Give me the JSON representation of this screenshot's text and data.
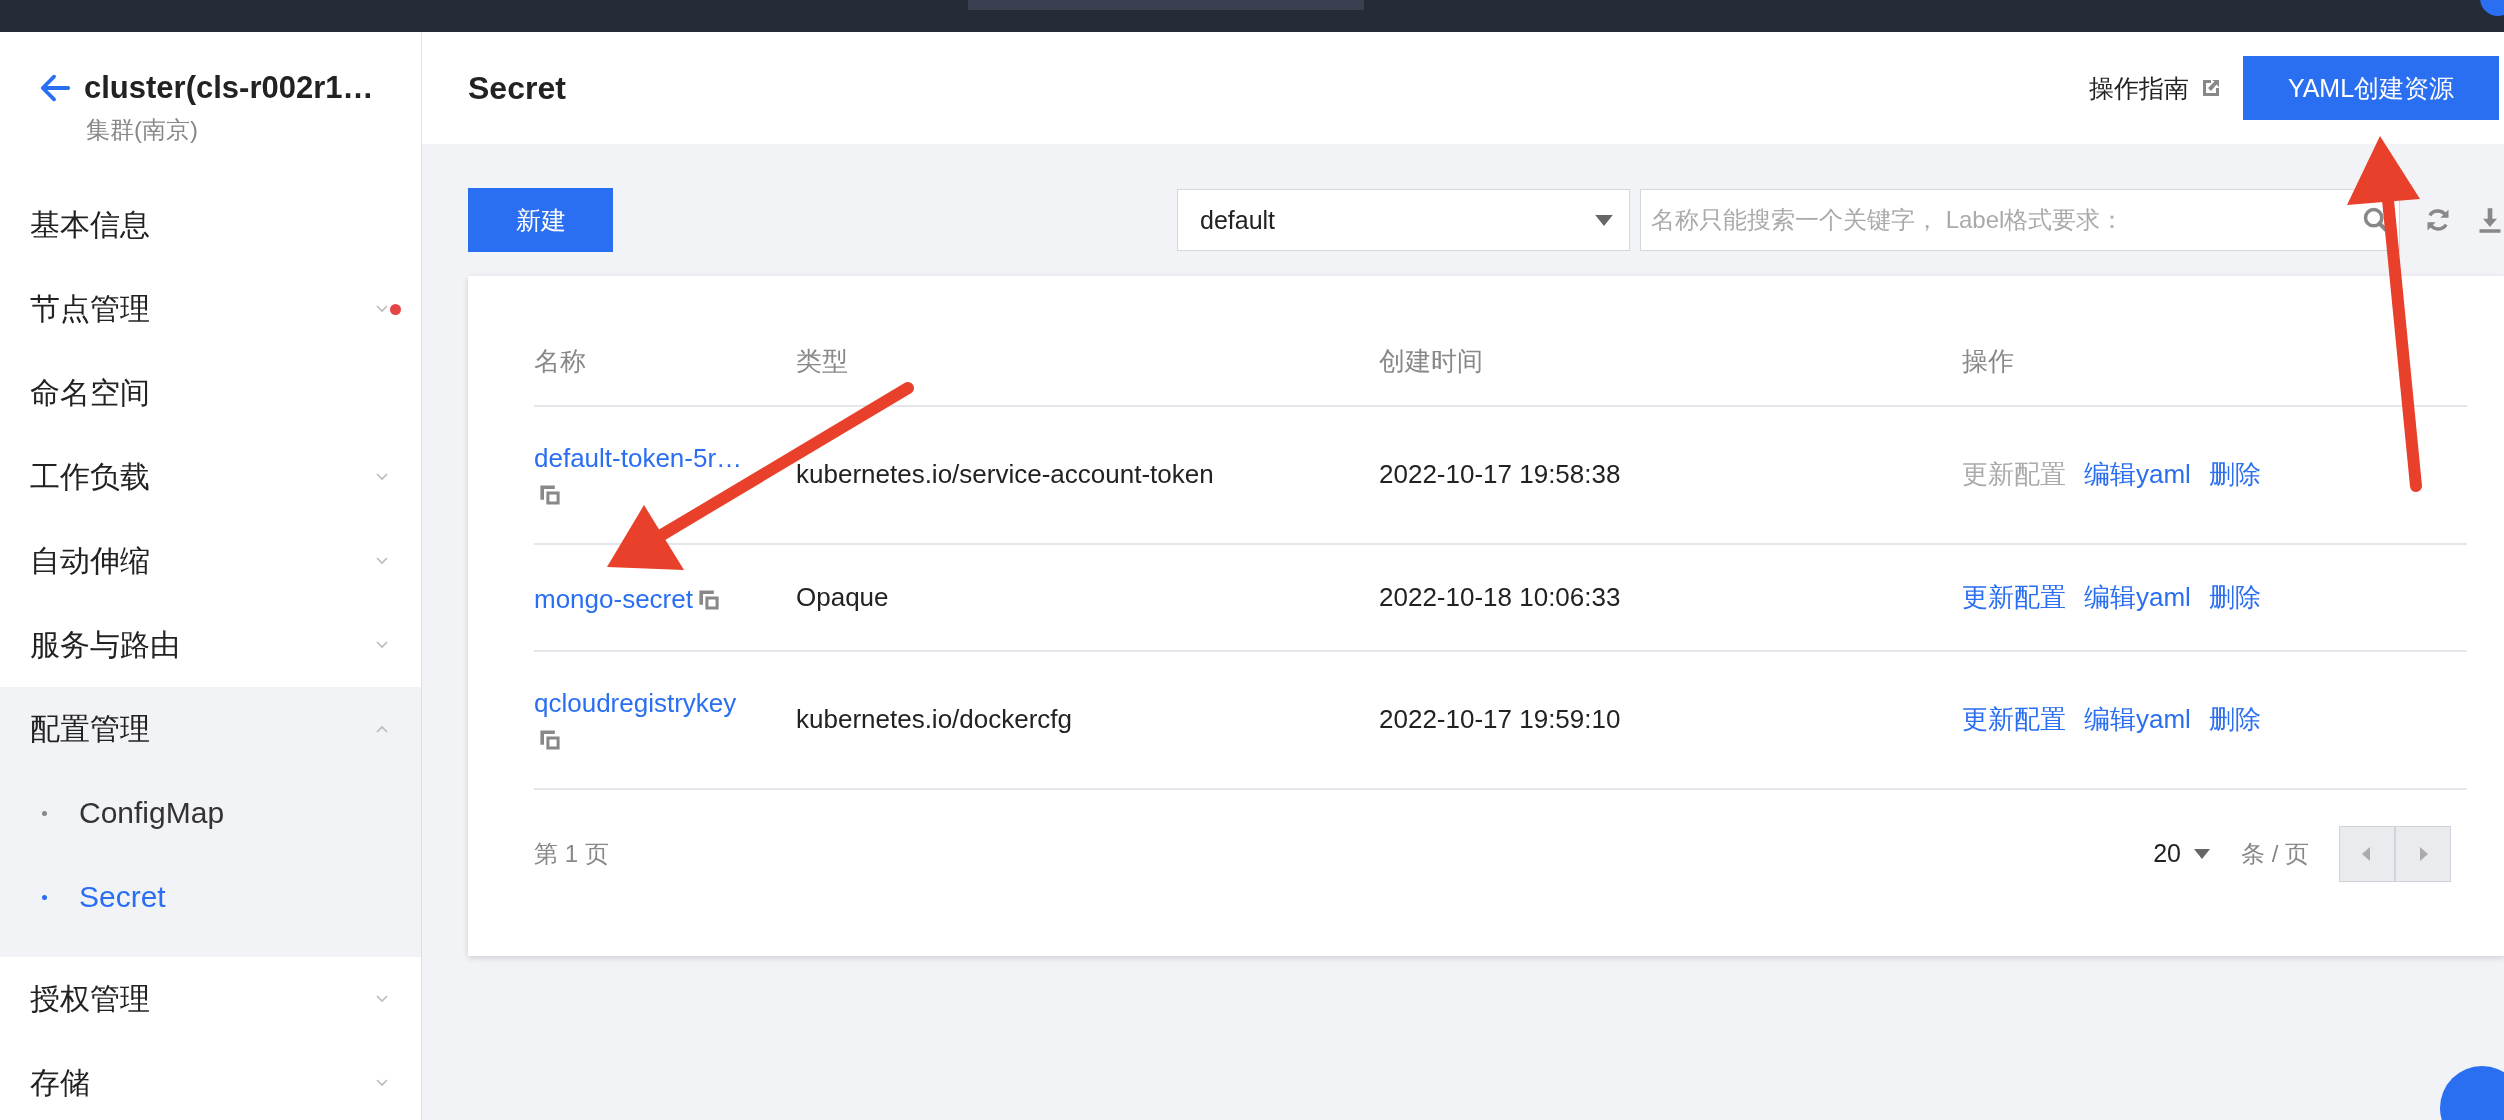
{
  "sidebar": {
    "back": true,
    "title": "cluster(cls-r002r1…",
    "subtitle": "集群(南京)",
    "items": [
      {
        "label": "基本信息",
        "kind": "link",
        "alert": false
      },
      {
        "label": "节点管理",
        "kind": "group",
        "expanded": false,
        "alert": true
      },
      {
        "label": "命名空间",
        "kind": "link",
        "alert": false
      },
      {
        "label": "工作负载",
        "kind": "group",
        "expanded": false,
        "alert": false
      },
      {
        "label": "自动伸缩",
        "kind": "group",
        "expanded": false,
        "alert": false
      },
      {
        "label": "服务与路由",
        "kind": "group",
        "expanded": false,
        "alert": false
      },
      {
        "label": "配置管理",
        "kind": "group",
        "expanded": true,
        "alert": false,
        "children": [
          {
            "label": "ConfigMap",
            "selected": false
          },
          {
            "label": "Secret",
            "selected": true
          }
        ]
      },
      {
        "label": "授权管理",
        "kind": "group",
        "expanded": false,
        "alert": false
      },
      {
        "label": "存储",
        "kind": "group",
        "expanded": false,
        "alert": false
      }
    ]
  },
  "header": {
    "title": "Secret",
    "guide_link": "操作指南",
    "primary_button": "YAML创建资源"
  },
  "toolbar": {
    "new_button": "新建",
    "namespace_select": "default",
    "search": {
      "placeholder": "名称只能搜索一个关键字， Label格式要求："
    }
  },
  "table": {
    "columns": [
      "名称",
      "类型",
      "创建时间",
      "操作"
    ],
    "rows": [
      {
        "name": "default-token-5r…",
        "type": "kubernetes.io/service-account-token",
        "created": "2022-10-17 19:58:38",
        "actions": [
          {
            "label": "更新配置",
            "disabled": true
          },
          {
            "label": "编辑yaml",
            "disabled": false
          },
          {
            "label": "删除",
            "disabled": false
          }
        ]
      },
      {
        "name": "mongo-secret",
        "type": "Opaque",
        "created": "2022-10-18 10:06:33",
        "actions": [
          {
            "label": "更新配置",
            "disabled": false
          },
          {
            "label": "编辑yaml",
            "disabled": false
          },
          {
            "label": "删除",
            "disabled": false
          }
        ]
      },
      {
        "name": "qcloudregistrykey",
        "type": "kubernetes.io/dockercfg",
        "created": "2022-10-17 19:59:10",
        "actions": [
          {
            "label": "更新配置",
            "disabled": false
          },
          {
            "label": "编辑yaml",
            "disabled": false
          },
          {
            "label": "删除",
            "disabled": false
          }
        ]
      }
    ]
  },
  "pagination": {
    "page": "第 1 页",
    "page_size": "20",
    "per_page_label": "条 / 页",
    "prev_disabled": true,
    "next_disabled": true
  }
}
